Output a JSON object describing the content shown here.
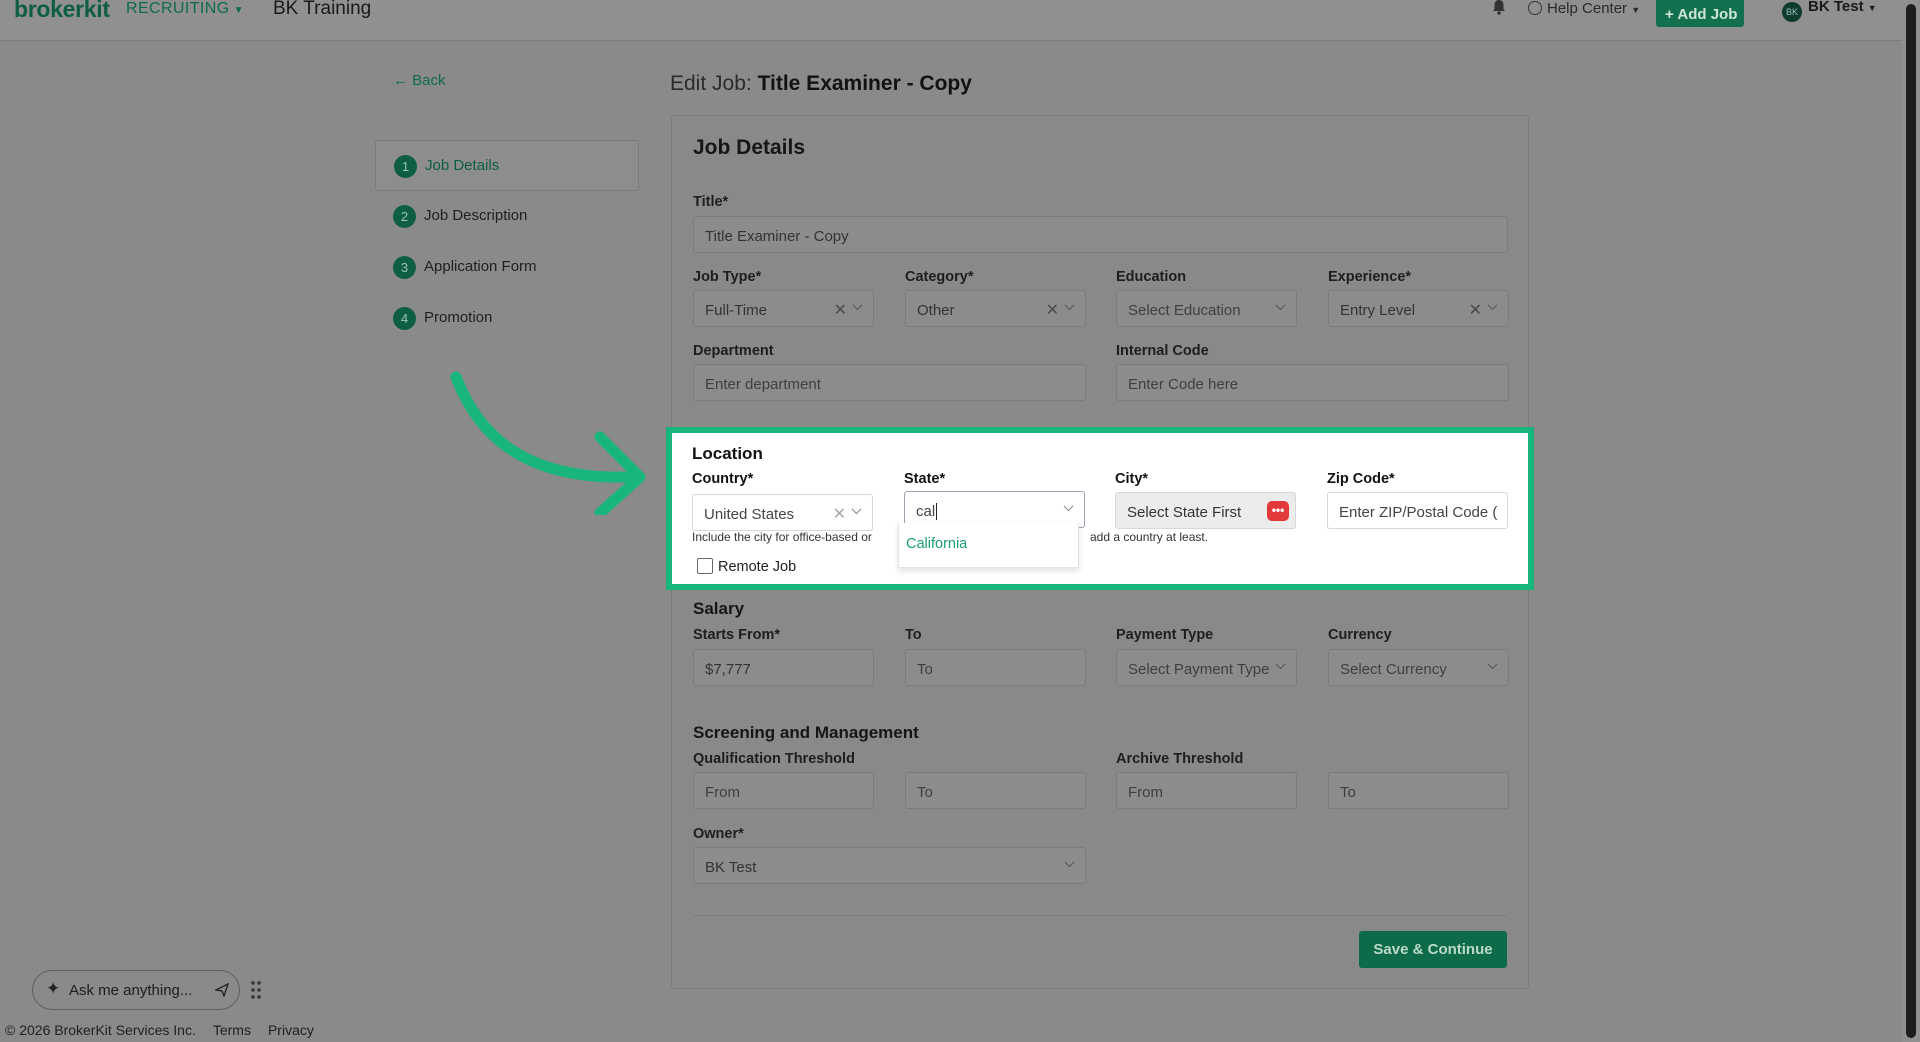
{
  "topbar": {
    "logo": "brokerkit",
    "product": "RECRUITING",
    "company": "BK Training",
    "help": "Help Center",
    "add_job": "+ Add Job",
    "user_initials": "BK",
    "user_name": "BK Test"
  },
  "nav": {
    "back": "Back",
    "steps": [
      {
        "num": "1",
        "label": "Job Details",
        "active": true
      },
      {
        "num": "2",
        "label": "Job Description",
        "active": false
      },
      {
        "num": "3",
        "label": "Application Form",
        "active": false
      },
      {
        "num": "4",
        "label": "Promotion",
        "active": false
      }
    ]
  },
  "page": {
    "title_prefix": "Edit Job:",
    "title": "Title Examiner - Copy"
  },
  "form": {
    "heading": "Job Details",
    "title_label": "Title*",
    "title_value": "Title Examiner - Copy",
    "job_type_label": "Job Type*",
    "job_type_value": "Full-Time",
    "category_label": "Category*",
    "category_value": "Other",
    "education_label": "Education",
    "education_placeholder": "Select Education",
    "experience_label": "Experience*",
    "experience_value": "Entry Level",
    "department_label": "Department",
    "department_placeholder": "Enter department",
    "internal_code_label": "Internal Code",
    "internal_code_placeholder": "Enter Code here",
    "location": {
      "heading": "Location",
      "country_label": "Country*",
      "country_value": "United States",
      "state_label": "State*",
      "state_value": "cal",
      "state_option": "California",
      "city_label": "City*",
      "city_placeholder": "Select State First",
      "city_badge": "•••",
      "zip_label": "Zip Code*",
      "zip_placeholder": "Enter ZIP/Postal Code (",
      "hint_left": "Include the city for office-based or",
      "hint_right": "add a country at least.",
      "remote_label": "Remote Job"
    },
    "salary": {
      "heading": "Salary",
      "starts_label": "Starts From*",
      "starts_value": "$7,777",
      "to_label": "To",
      "to_placeholder": "To",
      "payment_label": "Payment Type",
      "payment_placeholder": "Select Payment Type",
      "currency_label": "Currency",
      "currency_placeholder": "Select Currency"
    },
    "screening": {
      "heading": "Screening and Management",
      "qual_label": "Qualification Threshold",
      "qual_from": "From",
      "qual_to": "To",
      "archive_label": "Archive Threshold",
      "archive_from": "From",
      "archive_to": "To",
      "owner_label": "Owner*",
      "owner_value": "BK Test"
    },
    "save": "Save & Continue"
  },
  "assistant": {
    "placeholder": "Ask me anything..."
  },
  "footer": {
    "copyright": "© 2026 BrokerKit Services Inc.",
    "terms": "Terms",
    "privacy": "Privacy"
  },
  "colors": {
    "brand": "#0d6b4a",
    "highlight": "#18b57d",
    "badge": "#e23a3a"
  }
}
